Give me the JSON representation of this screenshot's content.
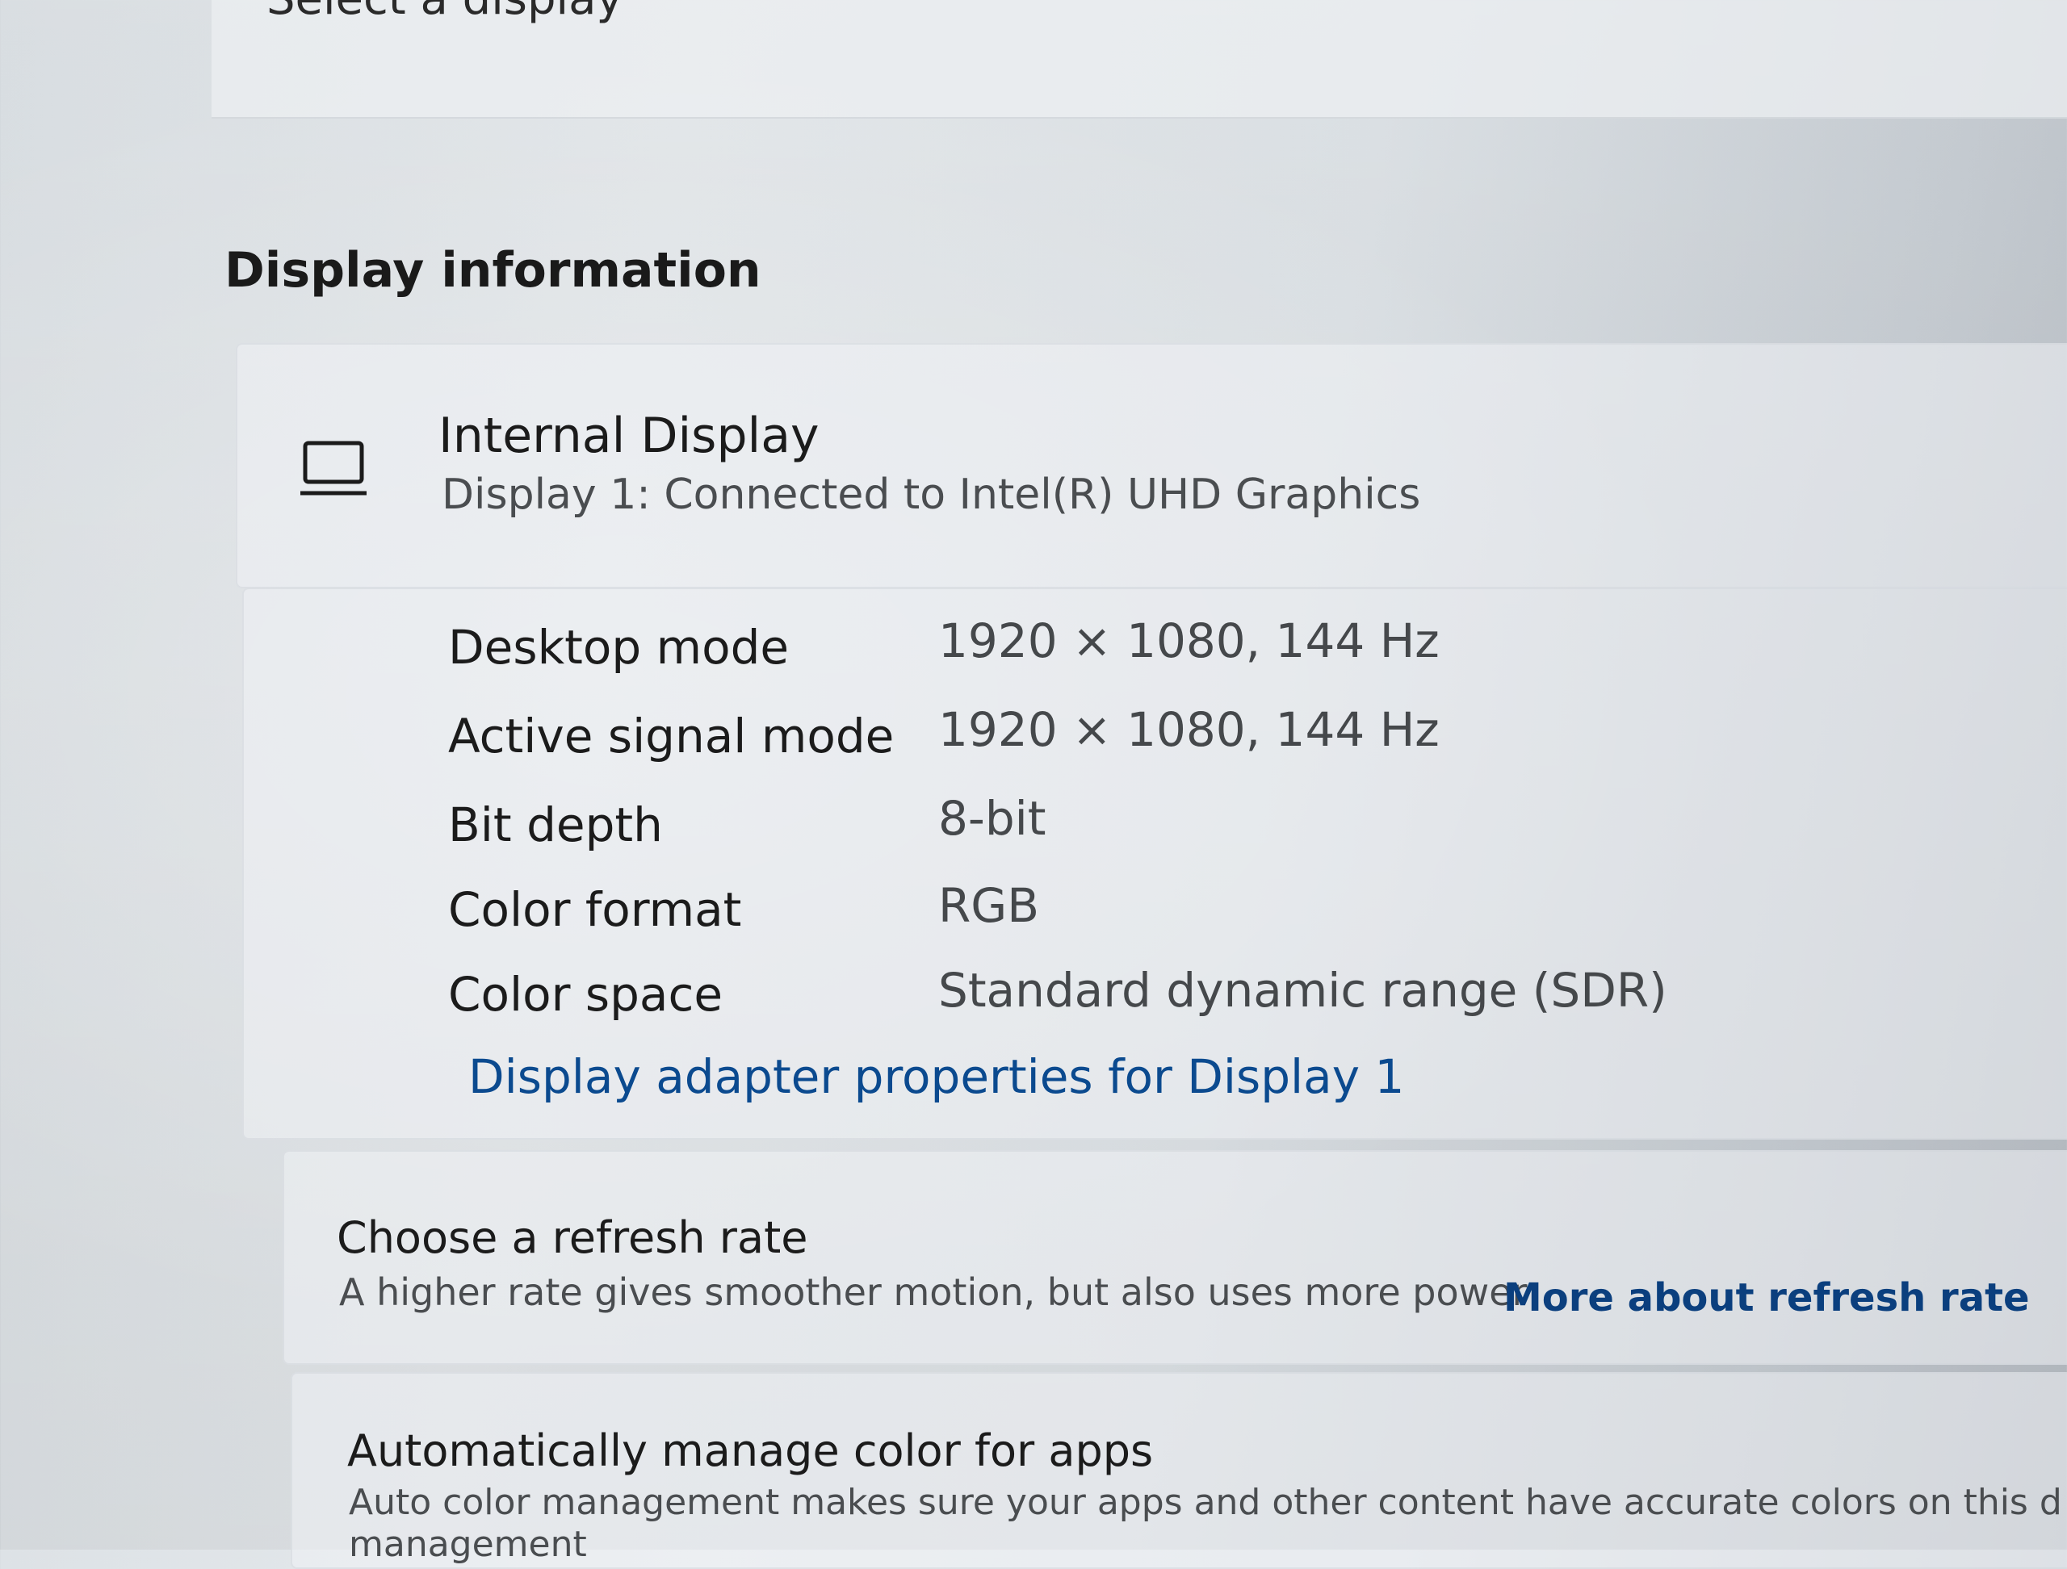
{
  "top_partial_label": "Select a display",
  "section": {
    "title": "Display information"
  },
  "display": {
    "icon": "laptop-icon",
    "name": "Internal Display",
    "connection": "Display 1: Connected to Intel(R) UHD Graphics"
  },
  "details": [
    {
      "label": "Desktop mode",
      "value": "1920 × 1080, 144 Hz"
    },
    {
      "label": "Active signal mode",
      "value": "1920 × 1080, 144 Hz"
    },
    {
      "label": "Bit depth",
      "value": "8-bit"
    },
    {
      "label": "Color format",
      "value": "RGB"
    },
    {
      "label": "Color space",
      "value": "Standard dynamic range (SDR)"
    }
  ],
  "adapter_link": "Display adapter properties for Display 1",
  "refresh": {
    "title": "Choose a refresh rate",
    "description": "A higher rate gives smoother motion, but also uses more power",
    "link": "More about refresh rate"
  },
  "color_management": {
    "title": "Automatically manage color for apps",
    "description": "Auto color management makes sure your apps and other content have accurate colors on this d",
    "description_cont": "management"
  },
  "colors": {
    "link": "#0b4a8f",
    "text_primary": "#1b1b1b",
    "text_secondary": "#4a4d50"
  }
}
